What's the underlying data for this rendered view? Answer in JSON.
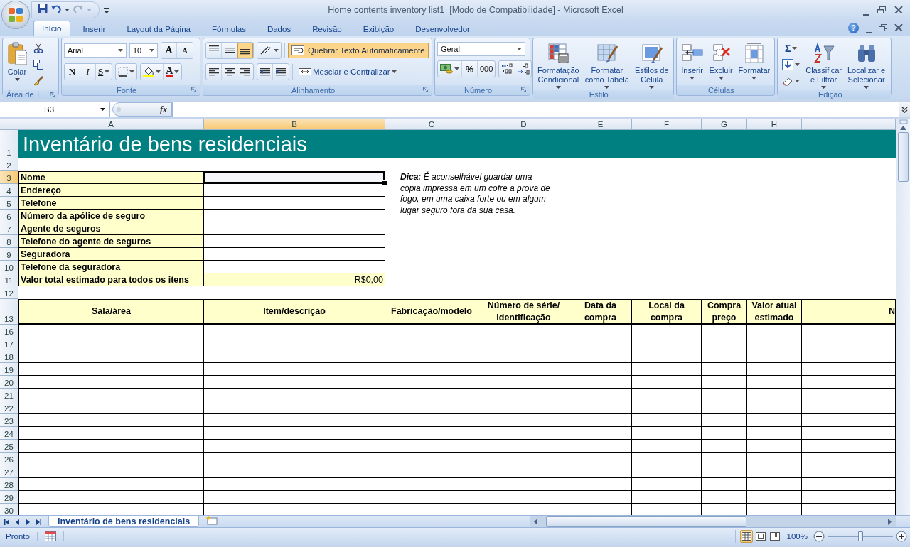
{
  "window": {
    "title": "Home contents inventory list1  [Modo de Compatibilidade] - Microsoft Excel"
  },
  "tabs": [
    {
      "label": "Início",
      "selected": true
    },
    {
      "label": "Inserir",
      "selected": false
    },
    {
      "label": "Layout da Página",
      "selected": false
    },
    {
      "label": "Fórmulas",
      "selected": false
    },
    {
      "label": "Dados",
      "selected": false
    },
    {
      "label": "Revisão",
      "selected": false
    },
    {
      "label": "Exibição",
      "selected": false
    },
    {
      "label": "Desenvolvedor",
      "selected": false
    }
  ],
  "help": "?",
  "ribbon": {
    "groups": [
      {
        "kind": "clipboard",
        "label": "Área de T...",
        "launcher": true,
        "paste": "Colar"
      },
      {
        "kind": "font",
        "label": "Fonte",
        "launcher": true,
        "font": "Arial",
        "size": "10",
        "grow": "A",
        "shrink": "A",
        "bold": "N",
        "italic": "I",
        "underline": "S",
        "font_color": "A"
      },
      {
        "kind": "alignment",
        "label": "Alinhamento",
        "launcher": true,
        "vertical_align": [
          {
            "selected": false
          },
          {
            "selected": false
          },
          {
            "selected": true
          }
        ],
        "wrap": {
          "label": "Quebrar Texto Automaticamente",
          "on": true
        },
        "merge": "Mesclar e Centralizar"
      },
      {
        "kind": "number",
        "label": "Número",
        "launcher": true,
        "format": "Geral",
        "percent": "%",
        "thousands": "000"
      },
      {
        "kind": "large",
        "label": "Estilo",
        "launcher": false,
        "buttons": [
          {
            "kind": "conditional",
            "label": "Formatação\nCondicional"
          },
          {
            "kind": "table",
            "label": "Formatar\ncomo Tabela"
          },
          {
            "kind": "styles",
            "label": "Estilos de\nCélula"
          }
        ]
      },
      {
        "kind": "large",
        "label": "Células",
        "launcher": false,
        "buttons": [
          {
            "kind": "insert",
            "label": "Inserir"
          },
          {
            "kind": "delete",
            "label": "Excluir"
          },
          {
            "kind": "format",
            "label": "Formatar"
          }
        ]
      },
      {
        "kind": "editing",
        "label": "Edição",
        "launcher": false,
        "sum": "Σ",
        "buttons": [
          {
            "kind": "sort",
            "label": "Classificar\ne Filtrar"
          },
          {
            "kind": "find",
            "label": "Localizar e\nSelecionar"
          }
        ]
      }
    ]
  },
  "formula_bar": {
    "name_box": "B3",
    "fx": "fx"
  },
  "sheet": {
    "columns": [
      {
        "label": "A",
        "selected": false
      },
      {
        "label": "B",
        "selected": true
      },
      {
        "label": "C",
        "selected": false
      },
      {
        "label": "D",
        "selected": false
      },
      {
        "label": "E",
        "selected": false
      },
      {
        "label": "F",
        "selected": false
      },
      {
        "label": "G",
        "selected": false
      },
      {
        "label": "H",
        "selected": false
      }
    ],
    "rows": [
      {
        "label": "1",
        "selected": false
      },
      {
        "label": "2",
        "selected": false
      },
      {
        "label": "3",
        "selected": true
      },
      {
        "label": "4",
        "selected": false
      },
      {
        "label": "5",
        "selected": false
      },
      {
        "label": "6",
        "selected": false
      },
      {
        "label": "7",
        "selected": false
      },
      {
        "label": "8",
        "selected": false
      },
      {
        "label": "9",
        "selected": false
      },
      {
        "label": "10",
        "selected": false
      },
      {
        "label": "11",
        "selected": false
      },
      {
        "label": "12",
        "selected": false
      },
      {
        "label": "13",
        "selected": false
      },
      {
        "label": "16",
        "selected": false
      },
      {
        "label": "17",
        "selected": false
      },
      {
        "label": "18",
        "selected": false
      },
      {
        "label": "19",
        "selected": false
      },
      {
        "label": "20",
        "selected": false
      },
      {
        "label": "21",
        "selected": false
      },
      {
        "label": "22",
        "selected": false
      },
      {
        "label": "23",
        "selected": false
      },
      {
        "label": "24",
        "selected": false
      },
      {
        "label": "25",
        "selected": false
      },
      {
        "label": "26",
        "selected": false
      },
      {
        "label": "27",
        "selected": false
      },
      {
        "label": "28",
        "selected": false
      },
      {
        "label": "29",
        "selected": false
      },
      {
        "label": "30",
        "selected": false
      }
    ],
    "title": "Inventário de bens residenciais",
    "info_fields": [
      {
        "kind": "text",
        "label": "Nome",
        "selected": true
      },
      {
        "kind": "text",
        "label": "Endereço",
        "selected": false
      },
      {
        "kind": "text",
        "label": "Telefone",
        "selected": false
      },
      {
        "kind": "text",
        "label": "Número da apólice de seguro",
        "selected": false
      },
      {
        "kind": "text",
        "label": "Agente de seguros",
        "selected": false
      },
      {
        "kind": "text",
        "label": "Telefone do agente de seguros",
        "selected": false
      },
      {
        "kind": "text",
        "label": "Seguradora",
        "selected": false
      },
      {
        "kind": "text",
        "label": "Telefone da seguradora",
        "selected": false
      },
      {
        "kind": "total",
        "label": "Valor total estimado para todos os itens",
        "value": "R$0,00",
        "selected": false
      }
    ],
    "tip": "**Dica:** É aconselhável guardar uma cópia impressa em um cofre à prova de fogo, em uma caixa forte ou em algum lugar seguro fora da sua casa.",
    "table": {
      "columns": [
        "Sala/área",
        "Item/descrição",
        "Fabricação/modelo",
        "Número de série/ Identificação",
        "Data da compra",
        "Local da compra",
        "Compra preço",
        "Valor atual estimado",
        "N"
      ]
    }
  },
  "sheet_tabs": [
    {
      "label": "Inventário de bens residenciais",
      "selected": true
    }
  ],
  "status_bar": {
    "text": "Pronto",
    "views": [
      {
        "selected": true
      },
      {
        "selected": false
      },
      {
        "selected": false
      }
    ],
    "zoom": "100%",
    "zoom_slider": {
      "level": 0.5
    }
  }
}
